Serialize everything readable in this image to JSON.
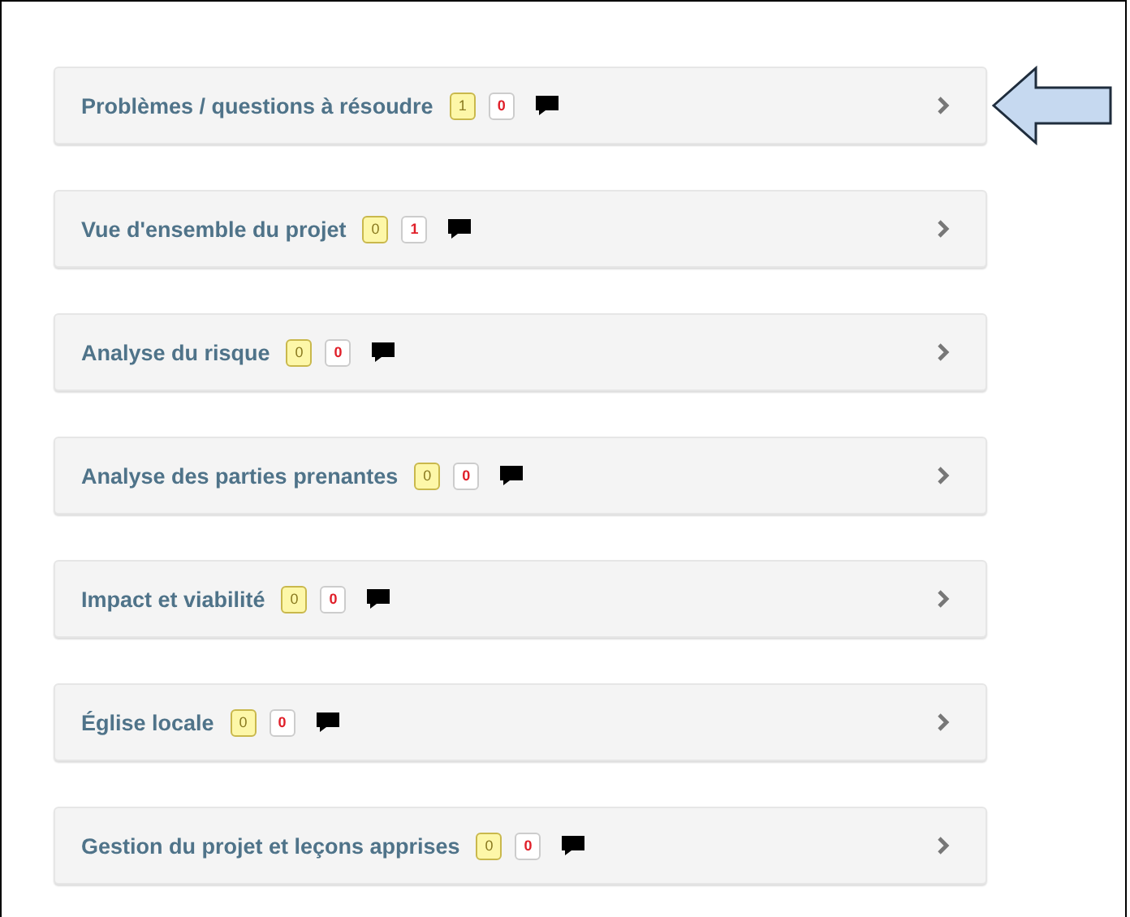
{
  "sections": [
    {
      "title": "Problèmes / questions à résoudre",
      "count_yellow": "1",
      "count_red": "0",
      "pointed": true
    },
    {
      "title": "Vue d'ensemble du projet",
      "count_yellow": "0",
      "count_red": "1",
      "pointed": false
    },
    {
      "title": "Analyse du risque",
      "count_yellow": "0",
      "count_red": "0",
      "pointed": false
    },
    {
      "title": "Analyse des parties prenantes",
      "count_yellow": "0",
      "count_red": "0",
      "pointed": false
    },
    {
      "title": "Impact et viabilité",
      "count_yellow": "0",
      "count_red": "0",
      "pointed": false
    },
    {
      "title": "Église locale",
      "count_yellow": "0",
      "count_red": "0",
      "pointed": false
    },
    {
      "title": "Gestion du projet et leçons apprises",
      "count_yellow": "0",
      "count_red": "0",
      "pointed": false
    }
  ]
}
